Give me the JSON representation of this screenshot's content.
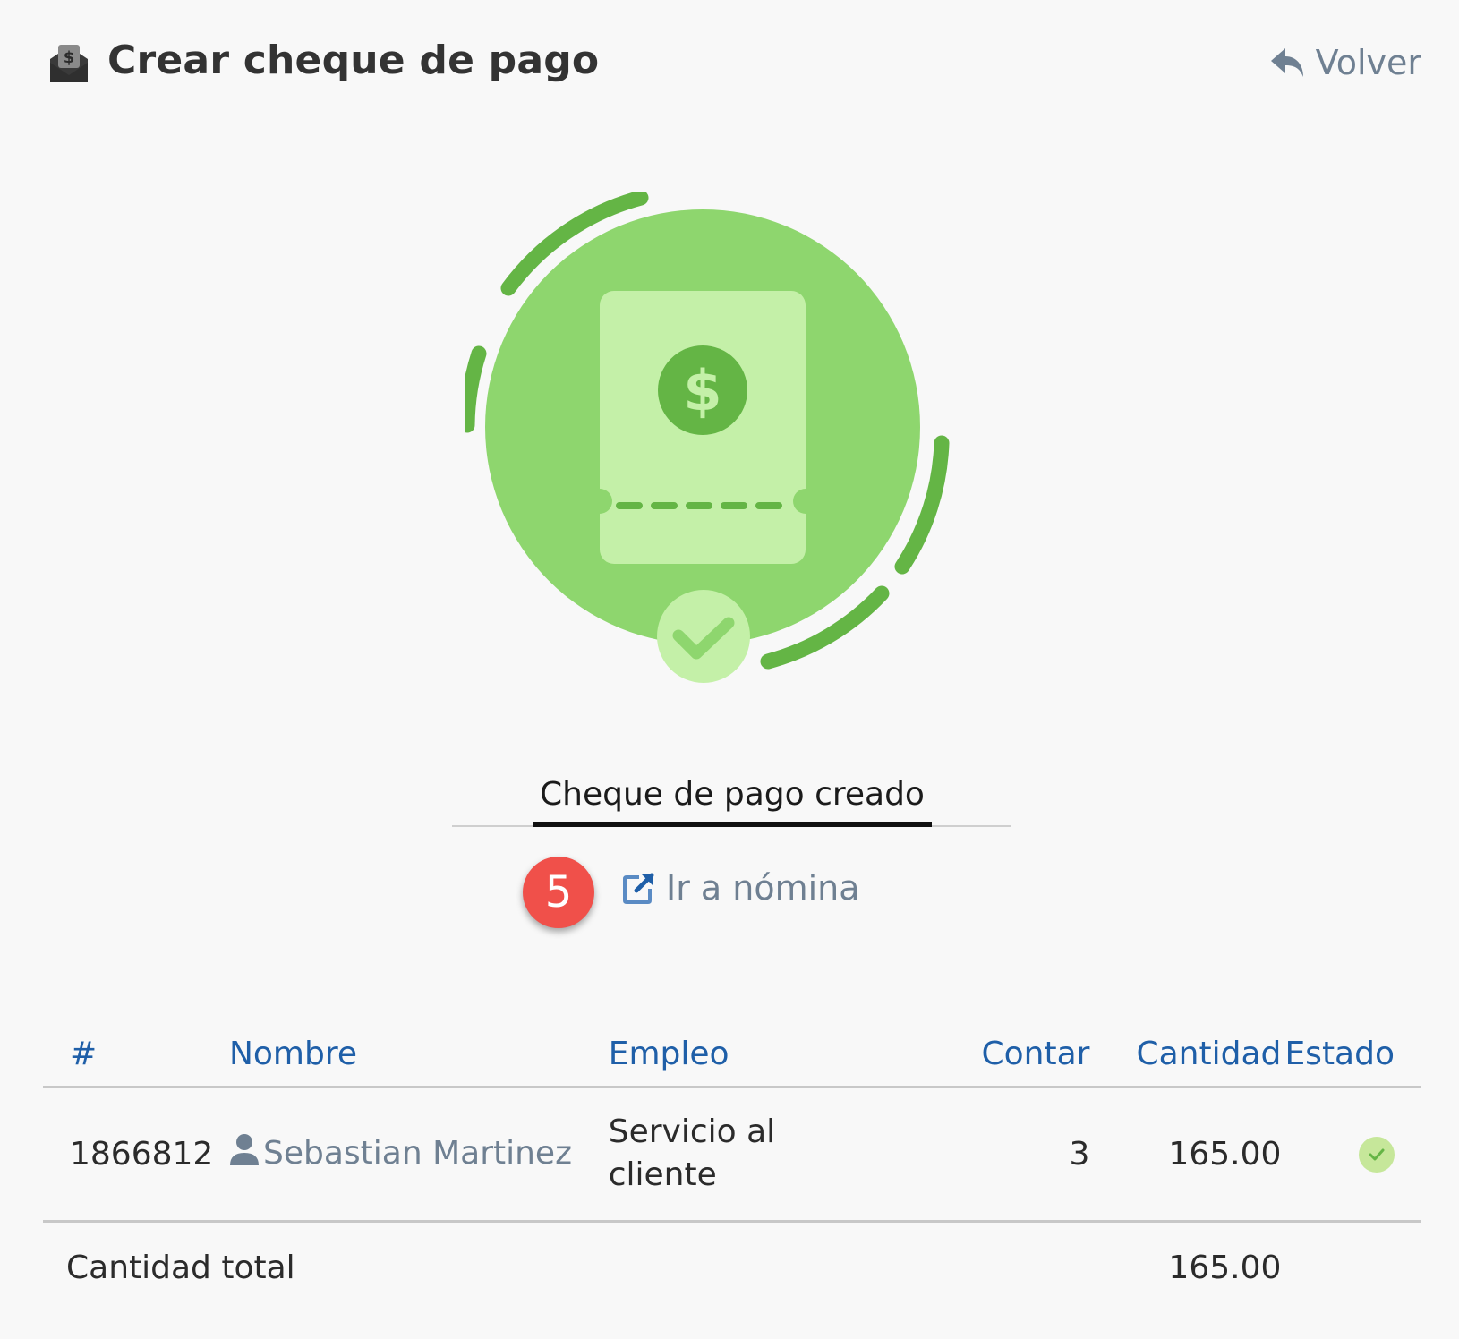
{
  "header": {
    "title": "Crear cheque de pago",
    "back_label": "Volver",
    "icon": "envelope-dollar-icon"
  },
  "illustration": {
    "icon": "paycheck-success-icon",
    "colors": {
      "circle": "#8ed66e",
      "ticket": "#c4f0a8",
      "accent": "#64b545",
      "check_circle": "#c4f0a8"
    }
  },
  "tab": {
    "label": "Cheque de pago creado"
  },
  "step_badge": {
    "number": "5",
    "color": "#f0504a"
  },
  "goto_link": {
    "label": "Ir a nómina",
    "icon": "external-link-icon"
  },
  "table": {
    "headers": {
      "id": "#",
      "name": "Nombre",
      "job": "Empleo",
      "count": "Contar",
      "amount": "Cantidad",
      "status": "Estado"
    },
    "rows": [
      {
        "id": "1866812",
        "name": "Sebastian Martinez",
        "job": "Servicio al cliente",
        "count": "3",
        "amount": "165.00",
        "status": "ok"
      }
    ],
    "total_label": "Cantidad total",
    "total_amount": "165.00"
  }
}
